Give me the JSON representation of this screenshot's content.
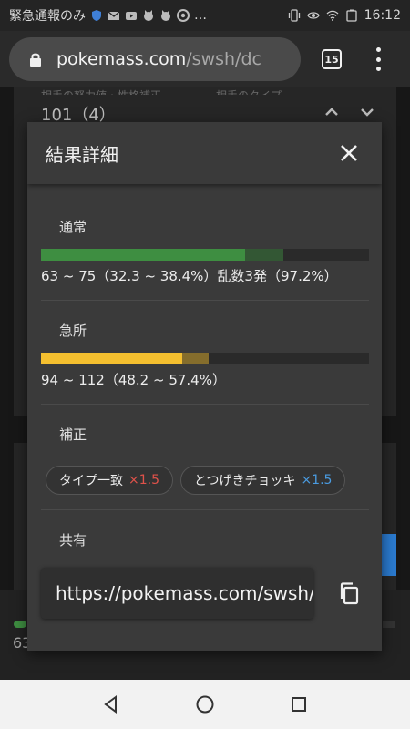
{
  "status_bar": {
    "notification_text": "緊急通報のみ",
    "overflow": "…",
    "battery": "!",
    "time": "16:12"
  },
  "browser": {
    "url_host": "pokemass.com",
    "url_path": "/swsh/dc",
    "tab_count": "15"
  },
  "background": {
    "labels": "相手の努力値・性格補正　　　　　相手のタイプ",
    "value": "101（4）",
    "bottom_text": "63"
  },
  "modal": {
    "title": "結果詳細",
    "normal": {
      "label": "通常",
      "result": "63 ~ 75（32.3 ~ 38.4%）乱数3発（97.2%）",
      "min_pct": 32.3,
      "max_pct": 38.4
    },
    "critical": {
      "label": "急所",
      "result": "94 ~ 112（48.2 ~ 57.4%）",
      "min_pct": 48.2,
      "max_pct": 57.4
    },
    "modifiers": {
      "label": "補正",
      "chips": [
        {
          "name": "タイプ一致",
          "mult": "×1.5",
          "mult_color": "#e0524a"
        },
        {
          "name": "とつげきチョッキ",
          "mult": "×1.5",
          "mult_color": "#4a9be0"
        }
      ]
    },
    "share": {
      "label": "共有",
      "url": "https://pokemass.com/swsh/dc"
    }
  },
  "colors": {
    "normal_bar": "#3e8e41",
    "critical_bar": "#f4bf2f",
    "track": "#2a2a2a"
  }
}
